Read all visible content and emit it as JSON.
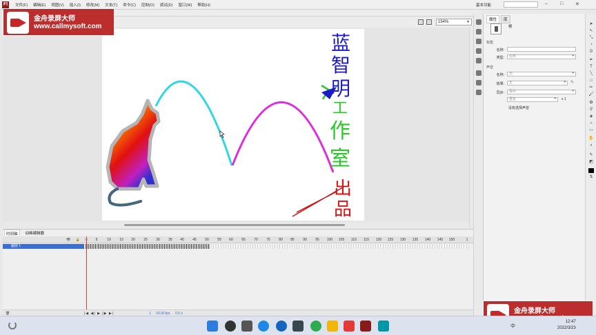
{
  "menu": {
    "items": [
      "文件(F)",
      "编辑(E)",
      "视图(V)",
      "插入(I)",
      "修改(M)",
      "文本(T)",
      "命令(C)",
      "控制(O)",
      "调试(D)",
      "窗口(W)",
      "帮助(H)"
    ],
    "workspace": "基本功能"
  },
  "watermark": {
    "title": "金舟录屏大师",
    "url": "www.callmysoft.com"
  },
  "stage": {
    "zoom": "154%",
    "vertical_text": [
      "蓝",
      "智",
      "明",
      "工",
      "作",
      "室",
      "出",
      "品"
    ],
    "text_colors": {
      "lan": "#1a1acc",
      "zhi": "#1a1acc",
      "ming": "#1a1acc",
      "gong": "#22cc22",
      "zuo": "#22cc22",
      "shi": "#22cc22",
      "chu": "#dd1111",
      "pin": "#dd1111"
    },
    "arc1_color": "#2fd6e6",
    "arc2_color": "#e02be0"
  },
  "timeline": {
    "tabs": [
      "时间轴",
      "动画编辑器"
    ],
    "layer_name": "图层 1",
    "ruler": [
      "5",
      "10",
      "15",
      "20",
      "25",
      "30",
      "35",
      "40",
      "45",
      "50",
      "55",
      "60",
      "65",
      "70",
      "75",
      "80",
      "85",
      "90",
      "95",
      "100",
      "105",
      "110",
      "115",
      "120",
      "125",
      "130",
      "135",
      "140",
      "145",
      "150",
      "1"
    ],
    "current_frame": "1",
    "fps": "24.00 fps",
    "time": "0.0 s"
  },
  "properties": {
    "tabs": [
      "属性",
      "库"
    ],
    "frame_label": "帧",
    "section_label": "标签",
    "name_label": "名称:",
    "type_label": "类型:",
    "type_value": "名称",
    "section_sound": "声音",
    "sound_name_label": "名称:",
    "sound_name_value": "无",
    "effect_label": "效果:",
    "effect_value": "无",
    "sync_label": "同步:",
    "sync_value": "事件",
    "repeat_value": "重复",
    "repeat_count": "x 1",
    "note": "没有选择声音"
  },
  "taskbar": {
    "time": "12:47",
    "date": "2022/3/23",
    "lang": "中"
  }
}
